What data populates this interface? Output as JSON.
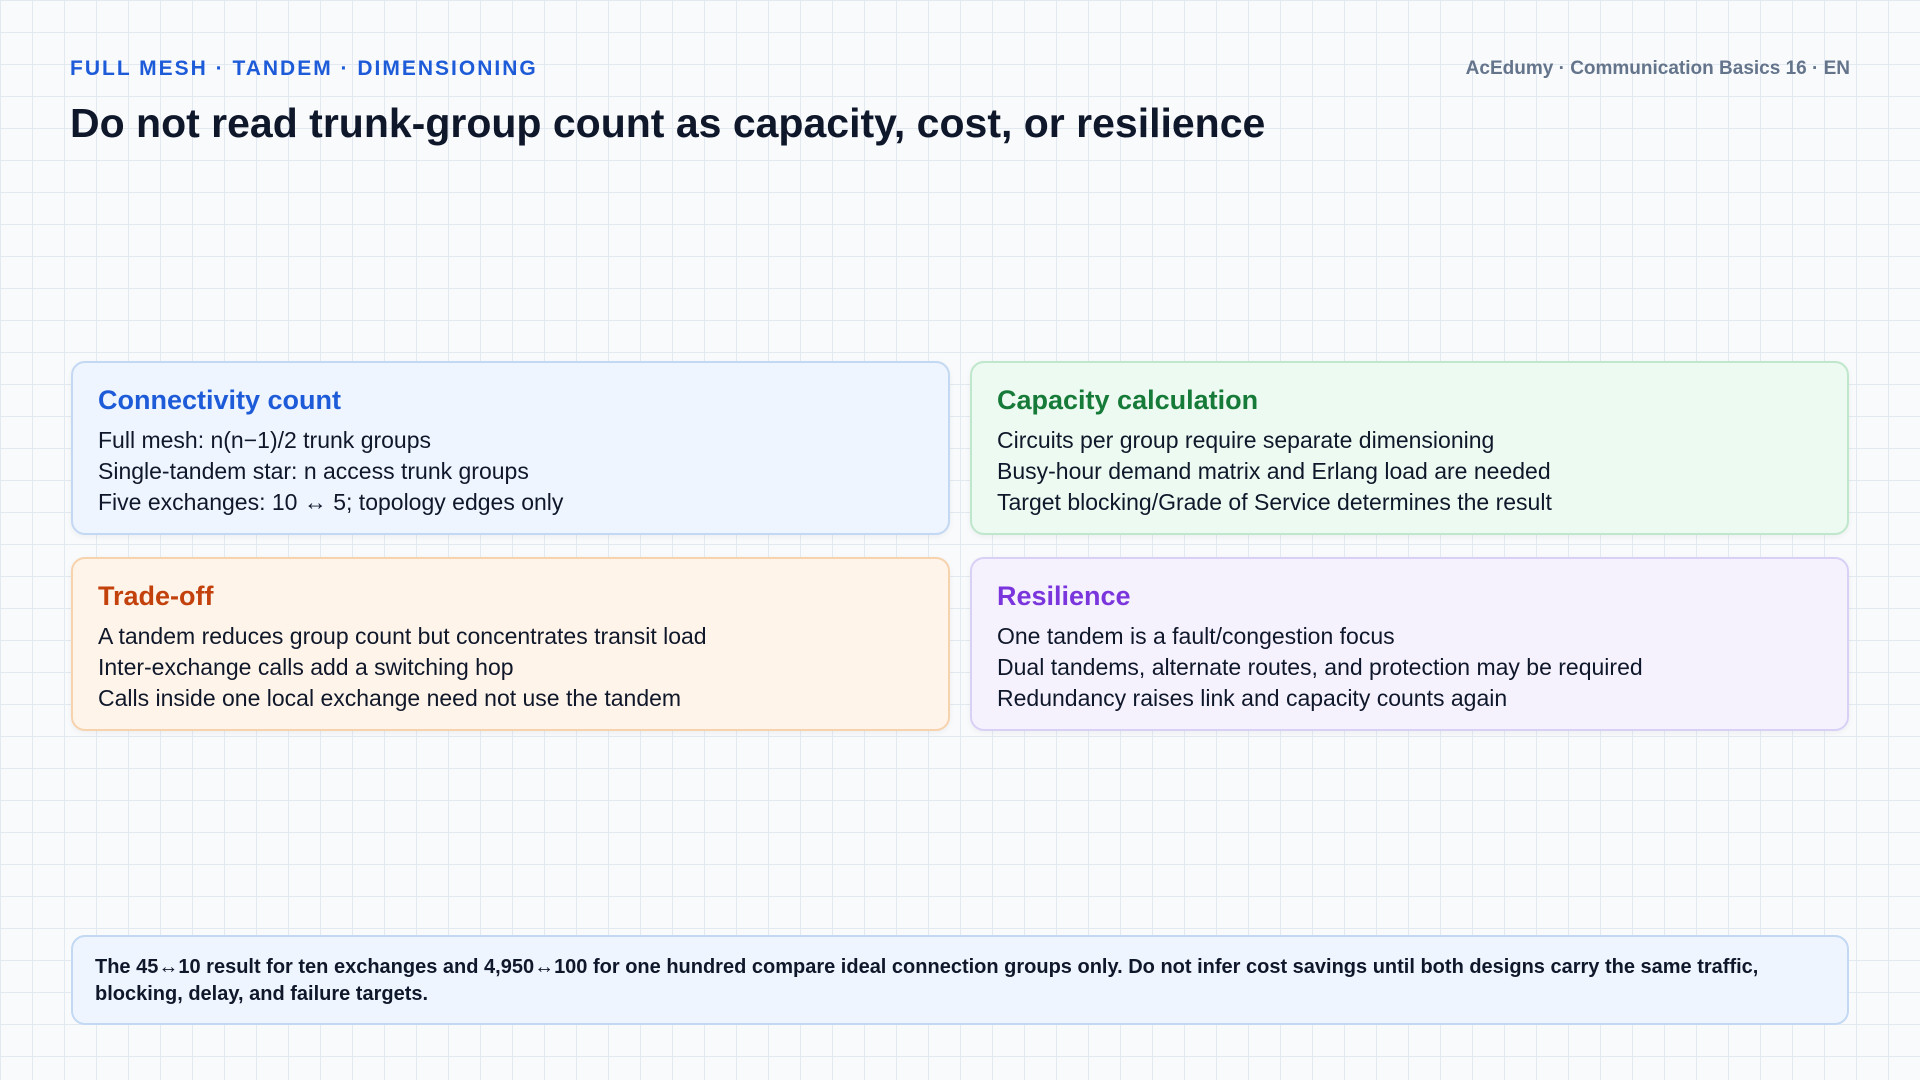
{
  "header": {
    "eyebrow": "FULL MESH · TANDEM · DIMENSIONING",
    "course": "AcEdumy · Communication Basics 16 · EN",
    "title": "Do not read trunk-group count as capacity, cost, or resilience"
  },
  "cards": [
    {
      "title": "Connectivity count",
      "accent": "#1d5bd8",
      "lines": [
        "Full mesh: n(n−1)/2 trunk groups",
        "Single-tandem star: n access trunk groups",
        "Five exchanges: 10 ↔ 5; topology edges only"
      ]
    },
    {
      "title": "Capacity calculation",
      "accent": "#167a38",
      "lines": [
        "Circuits per group require separate dimensioning",
        "Busy-hour demand matrix and Erlang load are needed",
        "Target blocking/Grade of Service determines the result"
      ]
    },
    {
      "title": "Trade-off",
      "accent": "#c2410c",
      "lines": [
        "A tandem reduces group count but concentrates transit load",
        "Inter-exchange calls add a switching hop",
        "Calls inside one local exchange need not use the tandem"
      ]
    },
    {
      "title": "Resilience",
      "accent": "#7a35dd",
      "lines": [
        "One tandem is a fault/congestion focus",
        "Dual tandems, alternate routes, and protection may be required",
        "Redundancy raises link and capacity counts again"
      ]
    }
  ],
  "note": {
    "text": "The 45↔10 result for ten exchanges and 4,950↔100 for one hundred compare ideal connection groups only. Do not infer cost savings until both designs carry the same traffic, blocking, delay, and failure targets."
  }
}
